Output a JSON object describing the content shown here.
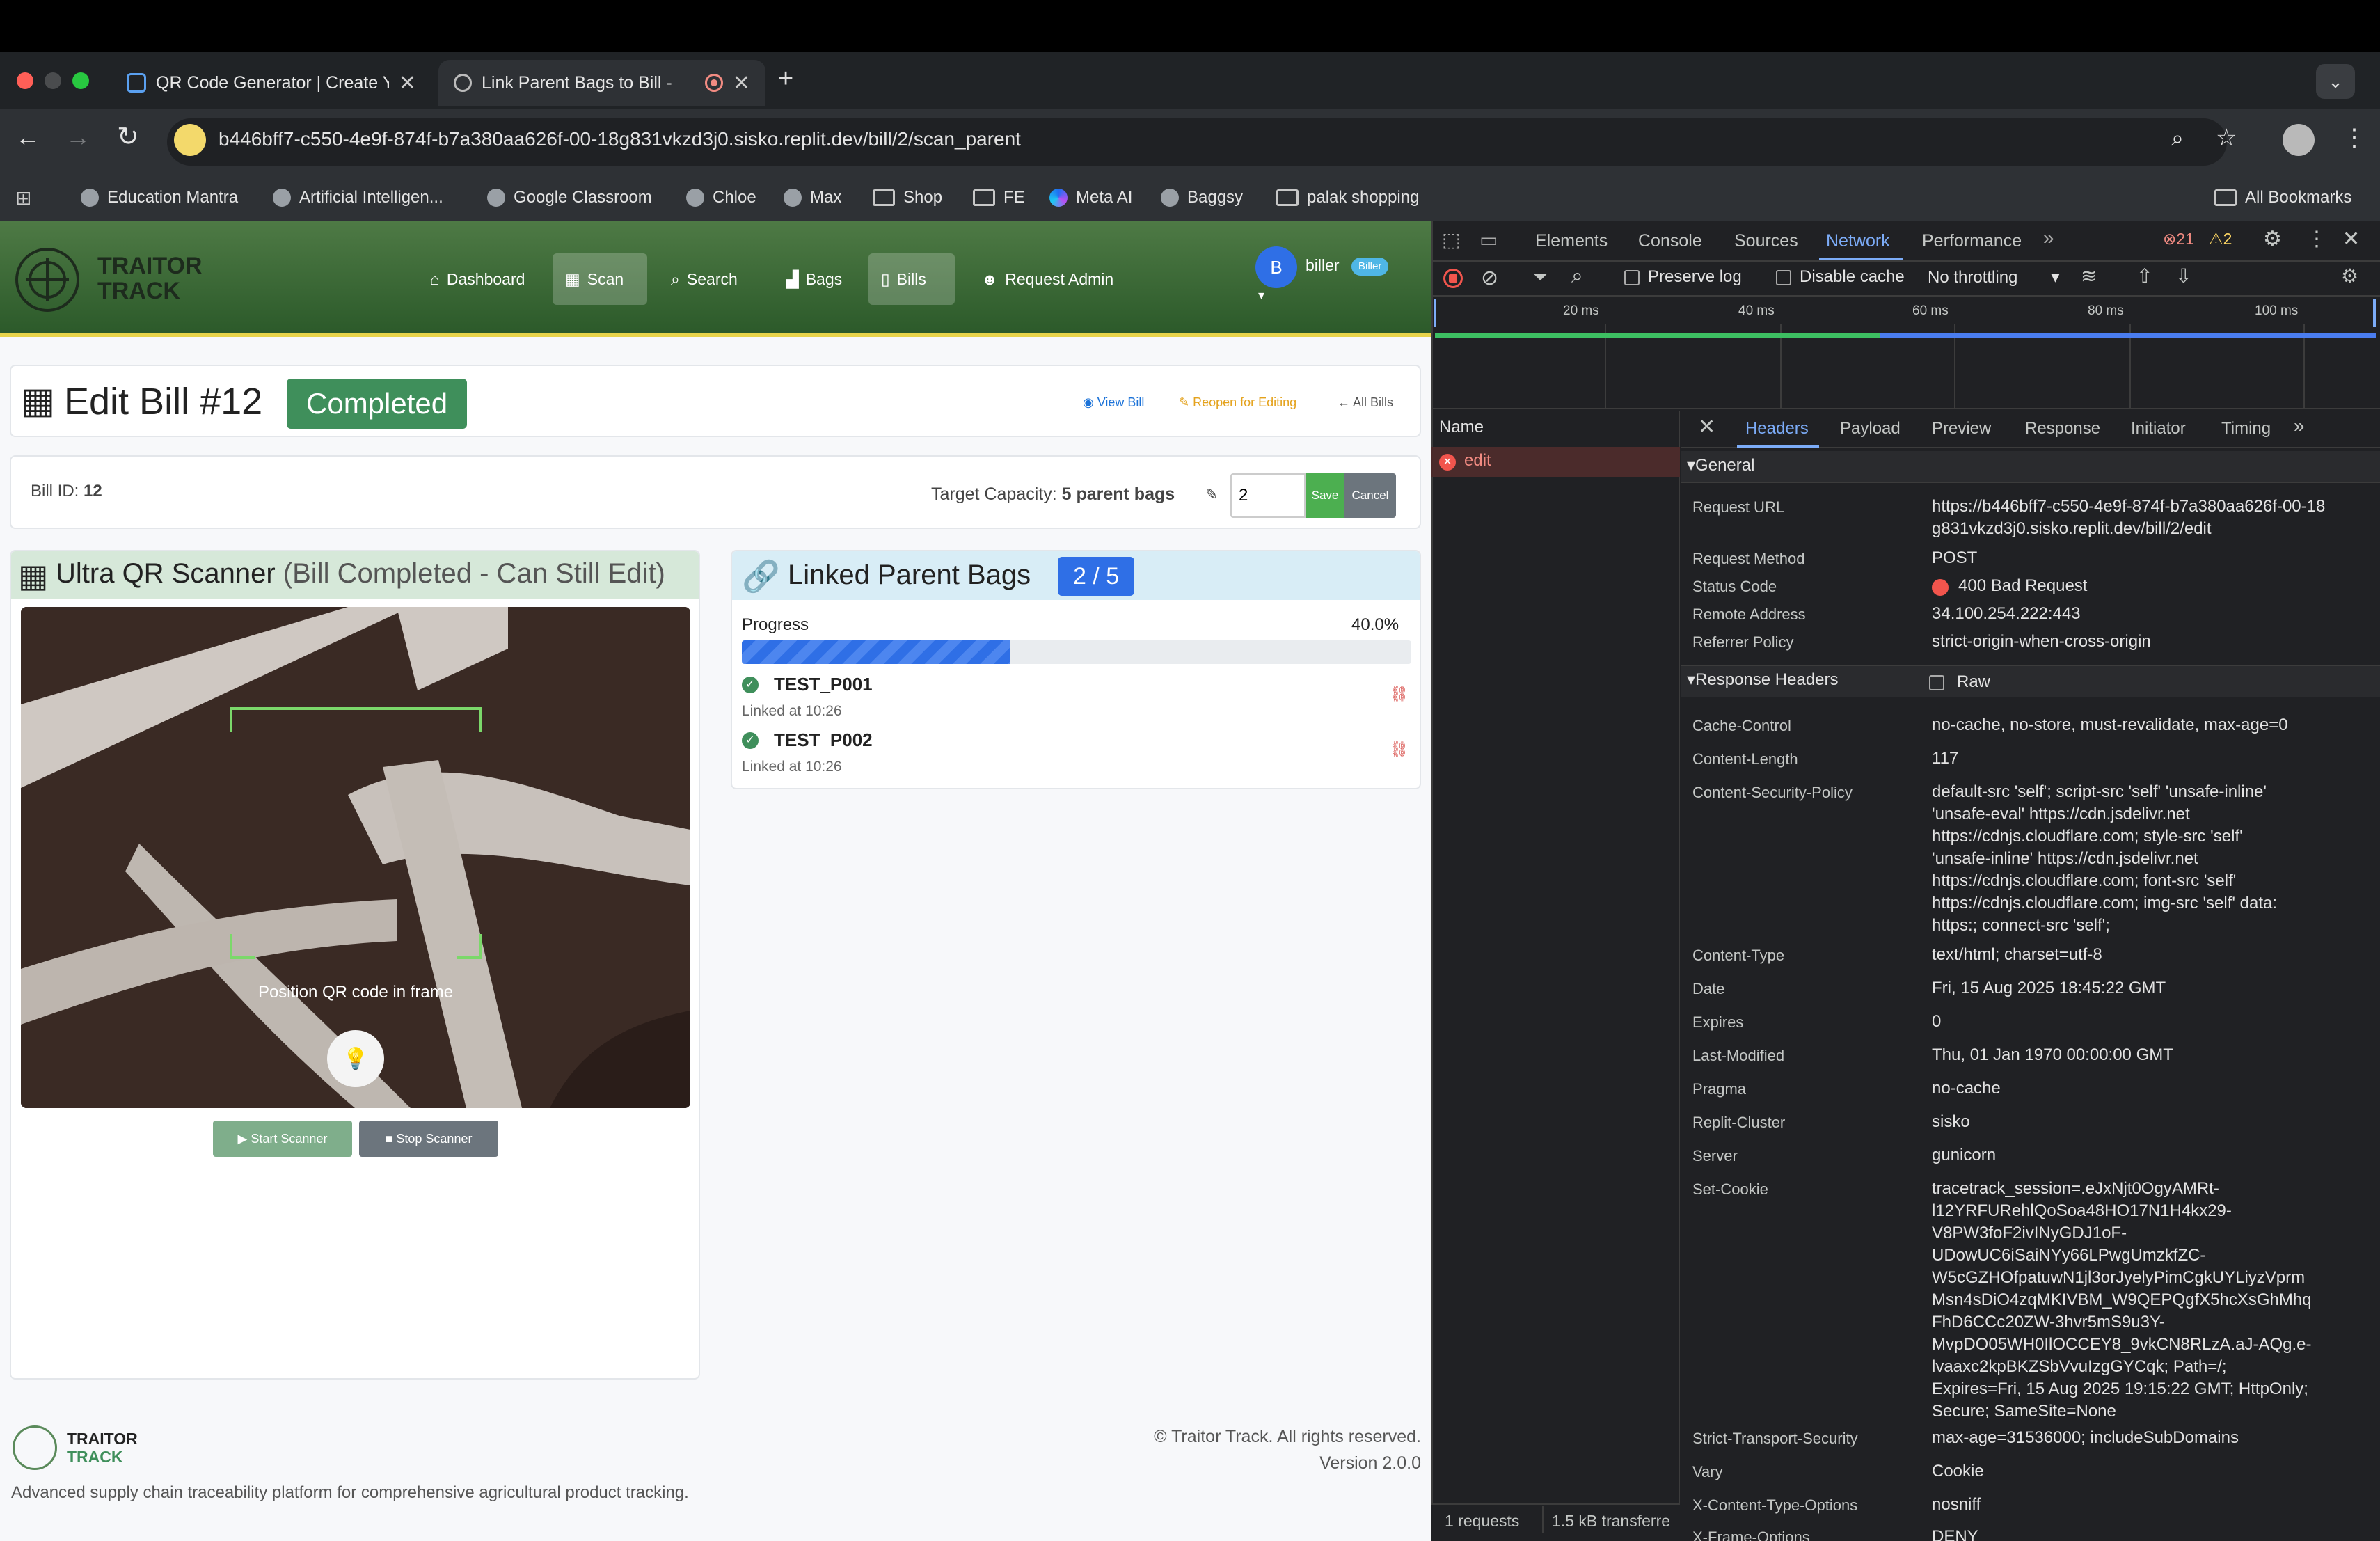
{
  "browser": {
    "tabs": [
      {
        "title": "QR Code Generator | Create Y"
      },
      {
        "title": "Link Parent Bags to Bill - "
      }
    ],
    "url": "b446bff7-c550-4e9f-874f-b7a380aa626f-00-18g831vkzd3j0.sisko.replit.dev/bill/2/scan_parent",
    "bookmarks": [
      "Education Mantra",
      "Artificial Intelligen...",
      "Google Classroom",
      "Chloe",
      "Max",
      "Shop",
      "FE",
      "Meta AI",
      "Baggsy",
      "palak shopping"
    ],
    "all_bookmarks": "All Bookmarks"
  },
  "app": {
    "brand_line1": "TRAITOR",
    "brand_line2": "TRACK",
    "nav": [
      "Dashboard",
      "Scan",
      "Search",
      "Bags",
      "Bills",
      "Request Admin"
    ],
    "user_initial": "B",
    "user_name": "biller",
    "user_role": "Biller"
  },
  "bill": {
    "title": "Edit Bill #12",
    "status": "Completed",
    "view_bill": "View Bill",
    "reopen": "Reopen for Editing",
    "all_bills": "All Bills",
    "id_label": "Bill ID:",
    "id_value": "12",
    "capacity_label": "Target Capacity:",
    "capacity_value": "5 parent bags",
    "capacity_input": "2",
    "save": "Save",
    "cancel": "Cancel"
  },
  "scanner": {
    "title": "Ultra QR Scanner",
    "subtitle": "(Bill Completed - Can Still Edit)",
    "hint": "Position QR code in frame",
    "start": "Start Scanner",
    "stop": "Stop Scanner"
  },
  "linked": {
    "title": "Linked Parent Bags",
    "count": "2 / 5",
    "progress_label": "Progress",
    "progress_text": "40.0%",
    "progress_value": 0.4,
    "items": [
      {
        "code": "TEST_P001",
        "time": "Linked at 10:26"
      },
      {
        "code": "TEST_P002",
        "time": "Linked at 10:26"
      }
    ]
  },
  "footer": {
    "brand_line1": "TRAITOR",
    "brand_line2": "TRACK",
    "description": "Advanced supply chain traceability platform for comprehensive agricultural product tracking.",
    "copyright": "© Traitor Track. All rights reserved.",
    "version": "Version 2.0.0"
  },
  "devtools": {
    "tabs": [
      "Elements",
      "Console",
      "Sources",
      "Network",
      "Performance"
    ],
    "errors": "21",
    "warnings": "2",
    "preserve_log": "Preserve log",
    "disable_cache": "Disable cache",
    "throttling": "No throttling",
    "timeline": [
      "20 ms",
      "40 ms",
      "60 ms",
      "80 ms",
      "100 ms"
    ],
    "name_col": "Name",
    "request_name": "edit",
    "detail_tabs": [
      "Headers",
      "Payload",
      "Preview",
      "Response",
      "Initiator",
      "Timing"
    ],
    "general_title": "General",
    "general": [
      {
        "k": "Request URL",
        "v": "https://b446bff7-c550-4e9f-874f-b7a380aa626f-00-18\ng831vkzd3j0.sisko.replit.dev/bill/2/edit"
      },
      {
        "k": "Request Method",
        "v": "POST"
      },
      {
        "k": "Status Code",
        "v": "400 Bad Request"
      },
      {
        "k": "Remote Address",
        "v": "34.100.254.222:443"
      },
      {
        "k": "Referrer Policy",
        "v": "strict-origin-when-cross-origin"
      }
    ],
    "response_title": "Response Headers",
    "raw": "Raw",
    "response": [
      {
        "k": "Cache-Control",
        "v": "no-cache, no-store, must-revalidate, max-age=0"
      },
      {
        "k": "Content-Length",
        "v": "117"
      },
      {
        "k": "Content-Security-Policy",
        "v": "default-src 'self'; script-src 'self' 'unsafe-inline'\n'unsafe-eval' https://cdn.jsdelivr.net\nhttps://cdnjs.cloudflare.com; style-src 'self'\n'unsafe-inline' https://cdn.jsdelivr.net\nhttps://cdnjs.cloudflare.com; font-src 'self'\nhttps://cdnjs.cloudflare.com; img-src 'self' data:\nhttps:; connect-src 'self';"
      },
      {
        "k": "Content-Type",
        "v": "text/html; charset=utf-8"
      },
      {
        "k": "Date",
        "v": "Fri, 15 Aug 2025 18:45:22 GMT"
      },
      {
        "k": "Expires",
        "v": "0"
      },
      {
        "k": "Last-Modified",
        "v": "Thu, 01 Jan 1970 00:00:00 GMT"
      },
      {
        "k": "Pragma",
        "v": "no-cache"
      },
      {
        "k": "Replit-Cluster",
        "v": "sisko"
      },
      {
        "k": "Server",
        "v": "gunicorn"
      },
      {
        "k": "Set-Cookie",
        "v": "tracetrack_session=.eJxNjt0OgyAMRt-\nl12YRFURehlQoSoa48HO17N1H4kx29-\nV8PW3foF2ivINyGDJ1oF-\nUDowUC6iSaiNYy66LPwgUmzkfZC-\nW5cGZHOfpatuwN1jl3orJyelyPimCgkUYLiyzVprm\nMsn4sDiO4zqMKIVBM_W9QEPQgfX5hcXsGhMhq\nFhD6CCc20ZW-3hvr5mS9u3Y-\nMvpDO05WH0IlOCCEY8_9vkCN8RLzA.aJ-AQg.e-\nlvaaxc2kpBKZSbVvuIzgGYCqk; Path=/;\nExpires=Fri, 15 Aug 2025 19:15:22 GMT; HttpOnly;\nSecure; SameSite=None"
      },
      {
        "k": "Strict-Transport-Security",
        "v": "max-age=31536000; includeSubDomains"
      },
      {
        "k": "Vary",
        "v": "Cookie"
      },
      {
        "k": "X-Content-Type-Options",
        "v": "nosniff"
      },
      {
        "k": "X-Frame-Options",
        "v": "DENY"
      }
    ],
    "status_requests": "1 requests",
    "status_transferred": "1.5 kB transferre"
  },
  "colors": {
    "nav_green": "#2c5a2a",
    "status_green": "#3f8f5b",
    "progress_blue": "#2f6fe6",
    "error_red": "#f2554d",
    "network_blue": "#7cacf8"
  }
}
